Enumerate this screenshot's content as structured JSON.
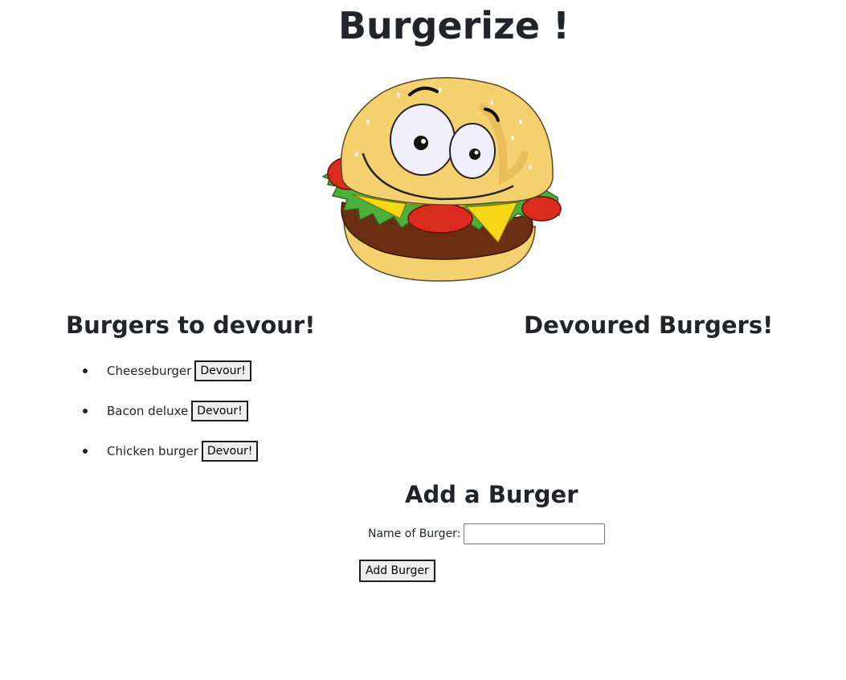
{
  "page": {
    "title": "Burgerize !"
  },
  "columns": {
    "todo_title": "Burgers to devour!",
    "done_title": "Devoured Burgers!"
  },
  "todo": [
    {
      "name": "Cheeseburger",
      "button": "Devour!"
    },
    {
      "name": "Bacon deluxe",
      "button": "Devour!"
    },
    {
      "name": "Chicken burger",
      "button": "Devour!"
    }
  ],
  "form": {
    "title": "Add a Burger",
    "label": "Name of Burger:",
    "value": "",
    "submit": "Add Burger"
  },
  "colors": {
    "text": "#212529",
    "bun": "#F4D06F",
    "tomato": "#D92B1E",
    "lettuce": "#4CAF3A",
    "cheese": "#F7D716",
    "patty": "#6B2E12"
  }
}
